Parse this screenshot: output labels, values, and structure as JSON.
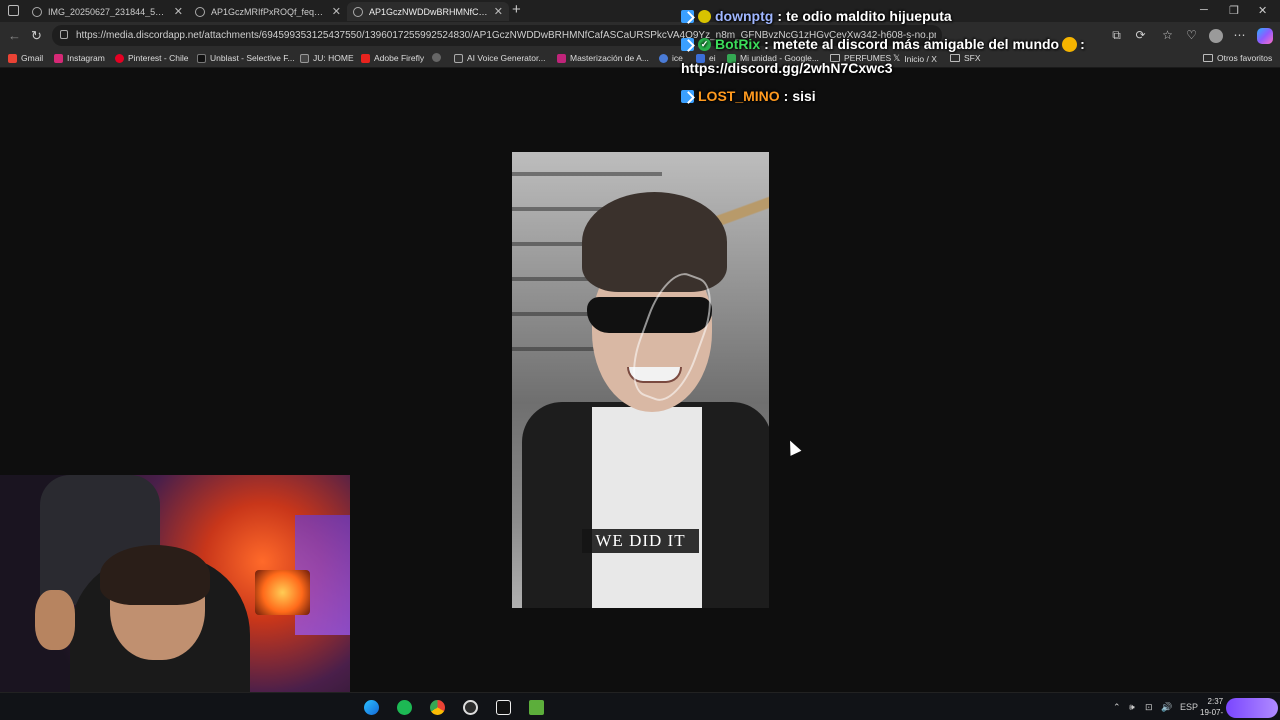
{
  "browser": {
    "tabs": [
      {
        "label": "IMG_20250627_231844_569.jpg (1",
        "active": false
      },
      {
        "label": "AP1GczMRIfPxROQf_feqdlvNcOA",
        "active": false
      },
      {
        "label": "AP1GczNWDDwBRHMNfCafASC",
        "active": true
      }
    ],
    "new_tab_label": "+",
    "url": "https://media.discordapp.net/attachments/694599353125437550/1396017255992524830/AP1GczNWDDwBRHMNfCafASCaURSPkcVA4Q9Yz_n8m_GFNBvzNcG1zHGvCevXw342-h608-s-no.png?ex=687c8de2"
  },
  "bookmarks": [
    {
      "label": "Gmail",
      "color": "#ea4335"
    },
    {
      "label": "Instagram",
      "color": "#d62976"
    },
    {
      "label": "Pinterest - Chile",
      "color": "#e60023"
    },
    {
      "label": "Unblast - Selective F...",
      "color": "#111111"
    },
    {
      "label": "JU: HOME",
      "color": "#444444"
    },
    {
      "label": "Adobe Firefly",
      "color": "#e8231e"
    },
    {
      "label": "",
      "color": "#666666"
    },
    {
      "label": "AI Voice Generator...",
      "color": "#333333"
    },
    {
      "label": "Masterización de A...",
      "color": "#c0247a"
    },
    {
      "label": "ice",
      "color": "#4a7bd6"
    },
    {
      "label": "ei",
      "color": "#3c6fd8"
    },
    {
      "label": "Mi unidad - Google...",
      "color": "#34a853"
    },
    {
      "label": "PERFUMES",
      "color": "folder"
    },
    {
      "label": "Inicio / X",
      "color": "#000000"
    },
    {
      "label": "SFX",
      "color": "folder"
    }
  ],
  "other_bookmarks_label": "Otros favoritos",
  "chat": [
    {
      "user": "downptg",
      "user_color": "#9fb6ff",
      "sep": ":",
      "message": "te odio maldito hijueputa"
    },
    {
      "user": "BotRix",
      "user_color": "#3cdc5a",
      "sep": ":",
      "message": "metete al discord más amigable del mundo",
      "message2": "https://discord.gg/2whN7Cxwc3"
    },
    {
      "user": "LOST_MINO",
      "user_color": "#ff9a1f",
      "sep": ":",
      "message": "sisi"
    }
  ],
  "image": {
    "caption": "WE DID IT"
  },
  "taskbar": {
    "language": "ESP",
    "time": "2:37",
    "date": "19-07-"
  },
  "icons": {
    "edge": "edge-icon",
    "spotify": "spotify-icon",
    "chrome": "chrome-icon",
    "obs": "obs-icon",
    "capcut": "capcut-icon",
    "minecraft": "minecraft-icon"
  }
}
